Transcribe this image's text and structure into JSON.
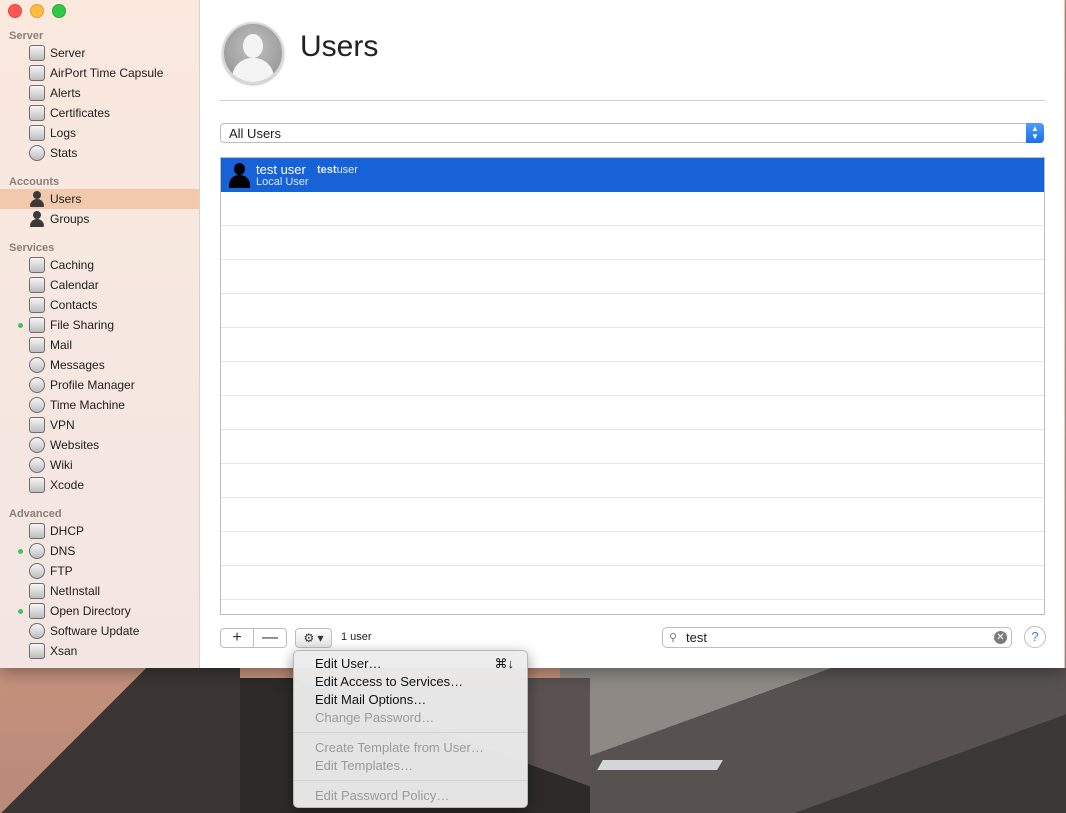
{
  "sidebar": {
    "sections": [
      {
        "label": "Server"
      },
      {
        "label": "Accounts"
      },
      {
        "label": "Services"
      },
      {
        "label": "Advanced"
      }
    ],
    "items": [
      {
        "label": "Server",
        "icon": "server-icon"
      },
      {
        "label": "AirPort Time Capsule",
        "icon": "airport-icon"
      },
      {
        "label": "Alerts",
        "icon": "alerts-icon"
      },
      {
        "label": "Certificates",
        "icon": "certificates-icon"
      },
      {
        "label": "Logs",
        "icon": "logs-icon"
      },
      {
        "label": "Stats",
        "icon": "stats-icon"
      },
      {
        "label": "Users",
        "icon": "user-icon",
        "selected": true
      },
      {
        "label": "Groups",
        "icon": "groups-icon"
      },
      {
        "label": "Caching",
        "icon": "caching-icon"
      },
      {
        "label": "Calendar",
        "icon": "calendar-icon"
      },
      {
        "label": "Contacts",
        "icon": "contacts-icon"
      },
      {
        "label": "File Sharing",
        "icon": "file-sharing-icon",
        "active": true
      },
      {
        "label": "Mail",
        "icon": "mail-icon"
      },
      {
        "label": "Messages",
        "icon": "messages-icon"
      },
      {
        "label": "Profile Manager",
        "icon": "profile-manager-icon"
      },
      {
        "label": "Time Machine",
        "icon": "time-machine-icon"
      },
      {
        "label": "VPN",
        "icon": "vpn-icon"
      },
      {
        "label": "Websites",
        "icon": "websites-icon"
      },
      {
        "label": "Wiki",
        "icon": "wiki-icon"
      },
      {
        "label": "Xcode",
        "icon": "xcode-icon"
      },
      {
        "label": "DHCP",
        "icon": "dhcp-icon"
      },
      {
        "label": "DNS",
        "icon": "dns-icon",
        "active": true
      },
      {
        "label": "FTP",
        "icon": "ftp-icon"
      },
      {
        "label": "NetInstall",
        "icon": "netinstall-icon"
      },
      {
        "label": "Open Directory",
        "icon": "open-directory-icon",
        "active": true
      },
      {
        "label": "Software Update",
        "icon": "software-update-icon"
      },
      {
        "label": "Xsan",
        "icon": "xsan-icon"
      }
    ]
  },
  "main": {
    "title": "Users",
    "filter": {
      "selected": "All Users"
    },
    "users": [
      {
        "name": "test user",
        "short_match": "test",
        "short_rest": "user",
        "type": "Local User"
      }
    ],
    "count_label": "1 user",
    "add_label": "+",
    "remove_label": "—",
    "gear_label": "⚙︎ ▾",
    "search": {
      "value": "test"
    },
    "help_label": "?"
  },
  "menu": {
    "items": [
      {
        "label": "Edit User…",
        "shortcut": "⌘↓",
        "enabled": true
      },
      {
        "label": "Edit Access to Services…",
        "enabled": true
      },
      {
        "label": "Edit Mail Options…",
        "enabled": true
      },
      {
        "label": "Change Password…",
        "enabled": false
      },
      {
        "label": "Create Template from User…",
        "enabled": false
      },
      {
        "label": "Edit Templates…",
        "enabled": false
      },
      {
        "label": "Edit Password Policy…",
        "enabled": false
      }
    ]
  },
  "colors": {
    "selection": "#1762d6",
    "sidebar_selection": "#f2c9ac",
    "status_dot": "#3fc45a"
  }
}
